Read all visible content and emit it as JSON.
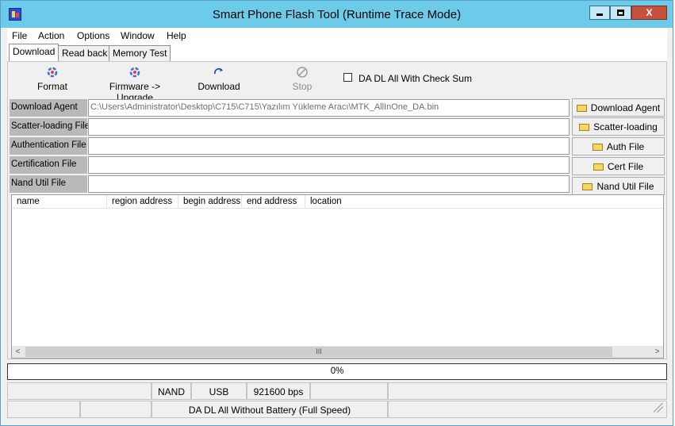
{
  "window": {
    "title": "Smart Phone Flash Tool (Runtime Trace Mode)",
    "close_label": "X"
  },
  "menu": [
    "File",
    "Action",
    "Options",
    "Window",
    "Help"
  ],
  "tabs": [
    "Download",
    "Read back",
    "Memory Test"
  ],
  "toolbar": {
    "format": "Format",
    "firmware_upgrade": "Firmware -> Upgrade",
    "download": "Download",
    "stop": "Stop",
    "checksum_label": "DA DL All With Check Sum"
  },
  "fields": [
    {
      "label": "Download Agent",
      "value": "C:\\Users\\Administrator\\Desktop\\C715\\C715\\Yazılım Yükleme Aracı\\MTK_AllInOne_DA.bin",
      "button": "Download Agent"
    },
    {
      "label": "Scatter-loading File",
      "value": "",
      "button": "Scatter-loading"
    },
    {
      "label": "Authentication File",
      "value": "",
      "button": "Auth File"
    },
    {
      "label": "Certification File",
      "value": "",
      "button": "Cert File"
    },
    {
      "label": "Nand Util File",
      "value": "",
      "button": "Nand Util File"
    }
  ],
  "list_columns": [
    "name",
    "region address",
    "begin address",
    "end address",
    "location"
  ],
  "scroll_grip": "III",
  "progress": {
    "percent": 0,
    "label": "0%"
  },
  "status": {
    "storage": "NAND",
    "connection": "USB",
    "baud": "921600 bps",
    "mode": "DA DL All Without Battery (Full Speed)"
  },
  "colors": {
    "titlebar": "#6ccbe9",
    "close_button": "#c7503f"
  }
}
